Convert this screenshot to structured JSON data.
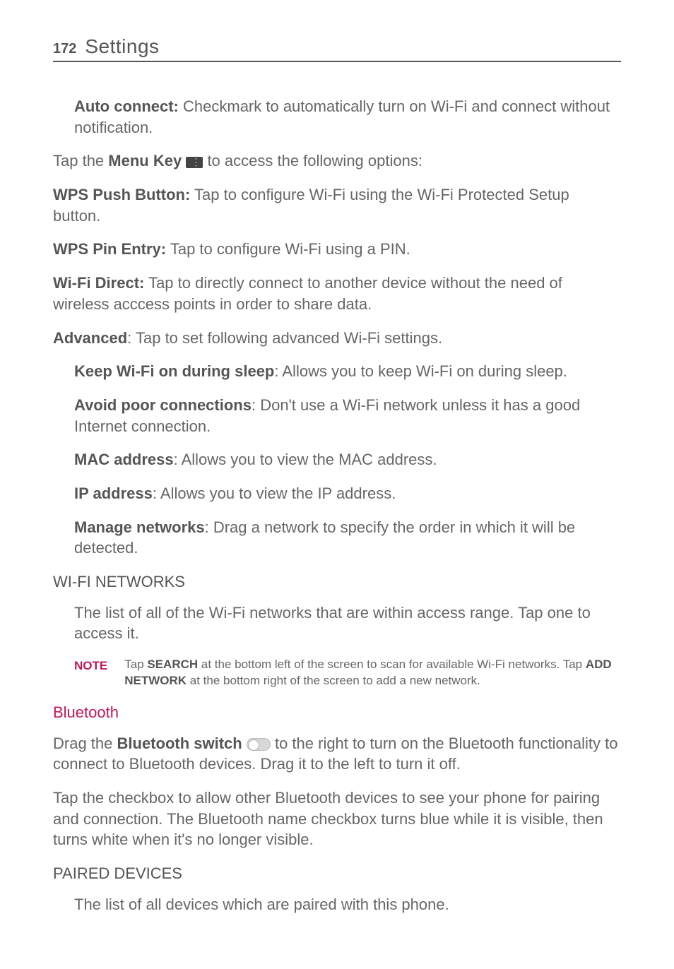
{
  "header": {
    "pageNumber": "172",
    "title": "Settings"
  },
  "p1": {
    "bold": "Auto connect:",
    "text": " Checkmark to automatically turn on Wi-Fi and connect without notification."
  },
  "p2": {
    "pre": "Tap the ",
    "bold": "Menu Key",
    "post": " to access the following options:"
  },
  "p3": {
    "bold": "WPS Push Button:",
    "text": " Tap to configure Wi-Fi using the Wi-Fi Protected Setup button."
  },
  "p4": {
    "bold": "WPS Pin Entry:",
    "text": " Tap to configure Wi-Fi using a PIN."
  },
  "p5": {
    "bold": "Wi-Fi Direct:",
    "text": " Tap to directly connect to another device without the need of wireless acccess points in order to share data."
  },
  "p6": {
    "bold": "Advanced",
    "text": ": Tap to set following advanced Wi-Fi settings."
  },
  "p7": {
    "bold": "Keep Wi-Fi on during sleep",
    "text": ": Allows you to keep Wi-Fi on during sleep."
  },
  "p8": {
    "bold": "Avoid poor connections",
    "text": ": Don't use a Wi-Fi network unless it has a good Internet connection."
  },
  "p9": {
    "bold": "MAC address",
    "text": ": Allows you to view the MAC address."
  },
  "p10": {
    "bold": "IP address",
    "text": ": Allows you to view the IP address."
  },
  "p11": {
    "bold": "Manage networks",
    "text": ": Drag a network to specify the order in which it will be detected."
  },
  "wifiNetworksHeading": "WI-FI NETWORKS",
  "p12": "The list of all of the Wi-Fi networks that are within access range. Tap one to access it.",
  "note": {
    "label": "NOTE",
    "pre": "Tap ",
    "b1": "SEARCH",
    "mid": " at the bottom left of the screen to scan for available Wi-Fi networks. Tap ",
    "b2": "ADD NETWORK",
    "post": " at the bottom right of the screen to add a new network."
  },
  "bluetoothHeading": "Bluetooth",
  "p13": {
    "pre": "Drag the ",
    "bold": "Bluetooth switch",
    "post": " to the right to turn on the Bluetooth functionality to connect to Bluetooth devices. Drag it to the left to turn it off."
  },
  "p14": "Tap the checkbox to allow other Bluetooth devices to see your phone for pairing and connection. The Bluetooth name checkbox turns blue while it is visible, then turns white when it's no longer visible.",
  "pairedHeading": "PAIRED DEVICES",
  "p15": "The list of all devices which are paired with this phone."
}
